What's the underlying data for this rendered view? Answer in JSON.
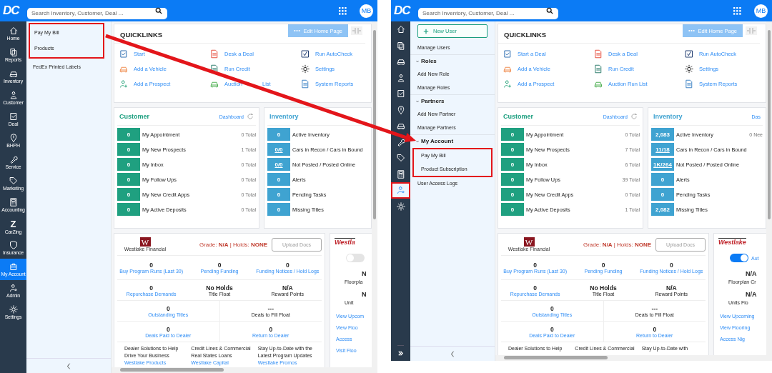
{
  "screens": [
    {
      "header": {
        "logo": "DC",
        "search_placeholder": "Search Inventory, Customer, Deal ...",
        "avatar": "MB"
      },
      "rail": [
        {
          "kind": "home",
          "label": "Home",
          "selected": false,
          "highlighted": false
        },
        {
          "kind": "reports",
          "label": "Reports",
          "selected": false,
          "highlighted": false
        },
        {
          "kind": "car",
          "label": "Inventory",
          "selected": false,
          "highlighted": false
        },
        {
          "kind": "person",
          "label": "Customer",
          "selected": false,
          "highlighted": false
        },
        {
          "kind": "deal",
          "label": "Deal",
          "selected": false,
          "highlighted": false
        },
        {
          "kind": "pin",
          "label": "BHPH",
          "selected": false,
          "highlighted": false
        },
        {
          "kind": "wrench",
          "label": "Service",
          "selected": false,
          "highlighted": false
        },
        {
          "kind": "tag",
          "label": "Marketing",
          "selected": false,
          "highlighted": false
        },
        {
          "kind": "calculator",
          "label": "Accounting",
          "selected": false,
          "highlighted": false
        },
        {
          "kind": "glyph",
          "glyph": "Z",
          "label": "CarZing",
          "selected": false,
          "highlighted": false
        },
        {
          "kind": "shield",
          "label": "Insurance",
          "selected": false,
          "highlighted": false
        },
        {
          "kind": "account",
          "label": "My Account",
          "selected": true,
          "highlighted": false
        },
        {
          "kind": "admin",
          "label": "Admin",
          "selected": false,
          "highlighted": false
        },
        {
          "kind": "gear",
          "label": "Settings",
          "selected": false,
          "highlighted": false
        }
      ],
      "rail_expand": false,
      "submenu": [
        {
          "kind": "highlight",
          "children": [
            {
              "kind": "link",
              "label": "Pay My Bill"
            },
            {
              "kind": "link",
              "label": "Products"
            }
          ]
        },
        {
          "kind": "link",
          "label": "FedEx Printed Labels"
        }
      ],
      "quicklinks": {
        "title": "QUICKLINKS",
        "edit_button": "Edit Home Page",
        "links": [
          {
            "kind": "deal",
            "label": "Start"
          },
          {
            "kind": "desk",
            "label": "Desk a Deal"
          },
          {
            "kind": "check",
            "label": "Run AutoCheck"
          },
          {
            "kind": "car",
            "label": "Add a Vehicle"
          },
          {
            "kind": "credit",
            "label": "Run Credit"
          },
          {
            "kind": "gear",
            "label": "Settings"
          },
          {
            "kind": "prospect",
            "label": "Add a Prospect"
          },
          {
            "kind": "auction",
            "label": "Auction",
            "tail": "List"
          },
          {
            "kind": "report",
            "label": "System Reports"
          }
        ]
      },
      "customer": {
        "title": "Customer",
        "link": "Dashboard",
        "rows": [
          {
            "count": "0",
            "label": "My Appointment",
            "total": "0 Total"
          },
          {
            "count": "0",
            "label": "My New Prospects",
            "total": "1 Total"
          },
          {
            "count": "0",
            "label": "My Inbox",
            "total": "0 Total"
          },
          {
            "count": "0",
            "label": "My Follow Ups",
            "total": "0 Total"
          },
          {
            "count": "0",
            "label": "My New Credit Apps",
            "total": "0 Total"
          },
          {
            "count": "0",
            "label": "My Active Deposits",
            "total": "0 Total"
          }
        ]
      },
      "inventory": {
        "title": "Inventory",
        "rows": [
          {
            "count": "0",
            "kind": "plain",
            "label": "Active Inventory"
          },
          {
            "count": "0/0",
            "kind": "link",
            "label": "Cars in Recon / Cars in Bound"
          },
          {
            "count": "0/0",
            "kind": "link",
            "label": "Not Posted / Posted Online"
          },
          {
            "count": "0",
            "kind": "plain",
            "label": "Alerts"
          },
          {
            "count": "0",
            "kind": "plain",
            "label": "Pending Tasks"
          },
          {
            "count": "0",
            "kind": "plain",
            "label": "Missing Titles"
          }
        ]
      },
      "westlake": {
        "logo_mark": "W",
        "logo_text": "Westlake Financial",
        "grade": "Grade: **N/A** | Holds: **NONE**",
        "upload_button": "Upload Docs",
        "stat_rows": [
          [
            {
              "value": "0",
              "label": "Buy Program Runs (Last 30)",
              "kind": "link"
            },
            {
              "value": "0",
              "label": "Pending Funding",
              "kind": "link"
            },
            {
              "value": "0",
              "label": "Funding Notices / Hold Logs",
              "kind": "link"
            }
          ],
          [
            {
              "value": "0",
              "label": "Repurchase Demands",
              "kind": "link"
            },
            {
              "value": "No Holds",
              "label": "Title Float",
              "kind": "plain"
            },
            {
              "value": "N/A",
              "label": "Reward Points",
              "kind": "plain"
            }
          ],
          [
            {
              "value": "0",
              "label": "Outstanding Titles",
              "kind": "link"
            },
            {
              "value": "---",
              "label": "Deals to Fill Float",
              "kind": "plain"
            }
          ],
          [
            {
              "value": "0",
              "label": "Deals Paid to Dealer",
              "kind": "link"
            },
            {
              "value": "0",
              "label": "Return to Dealer",
              "kind": "link"
            }
          ]
        ],
        "promos": [
          {
            "text": "Dealer Solutions to Help Drive Your Business",
            "link": "Westlake Products"
          },
          {
            "text": "Credit Lines & Commercial Real States Loans",
            "link": "Westlake Capital"
          },
          {
            "text": "Stay Up-to-Date with the Latest Program Updates",
            "link": "Westlake Promos"
          }
        ]
      },
      "flooring": {
        "logo": "Westla",
        "toggle_on": false,
        "items": [
          {
            "kind": "value",
            "text": "N"
          },
          {
            "kind": "caption",
            "text": "Floorpla"
          },
          {
            "kind": "value",
            "text": "N"
          },
          {
            "kind": "caption",
            "text": "Unit"
          },
          {
            "kind": "link",
            "text": "View Upcom"
          },
          {
            "kind": "link",
            "text": "View Floo"
          },
          {
            "kind": "link",
            "text": "Access"
          },
          {
            "kind": "link",
            "text": "Visit Floo"
          }
        ]
      }
    },
    {
      "header": {
        "logo": "DC",
        "search_placeholder": "Search Inventory, Customer, Deal ...",
        "avatar": "MB"
      },
      "rail": [
        {
          "kind": "home",
          "selected": false,
          "highlighted": false
        },
        {
          "kind": "reports",
          "selected": false,
          "highlighted": false
        },
        {
          "kind": "car",
          "selected": false,
          "highlighted": false
        },
        {
          "kind": "person",
          "selected": false,
          "highlighted": false
        },
        {
          "kind": "deal",
          "selected": false,
          "highlighted": false
        },
        {
          "kind": "pin",
          "selected": false,
          "highlighted": false
        },
        {
          "kind": "car",
          "selected": false,
          "highlighted": false
        },
        {
          "kind": "wrench",
          "selected": false,
          "highlighted": false
        },
        {
          "kind": "tag",
          "selected": false,
          "highlighted": false
        },
        {
          "kind": "calculator",
          "selected": false,
          "highlighted": false
        },
        {
          "kind": "admin",
          "selected": true,
          "highlighted": true
        },
        {
          "kind": "gear",
          "selected": false,
          "highlighted": false
        }
      ],
      "rail_expand": true,
      "submenu": [
        {
          "kind": "button",
          "label": "New User"
        },
        {
          "kind": "link",
          "label": "Manage Users"
        },
        {
          "kind": "group",
          "label": "Roles",
          "expanded": true,
          "children": [
            {
              "kind": "link",
              "label": "Add New Role"
            },
            {
              "kind": "link",
              "label": "Manage Roles"
            }
          ]
        },
        {
          "kind": "group",
          "label": "Partners",
          "expanded": true,
          "children": [
            {
              "kind": "link",
              "label": "Add New Partner"
            },
            {
              "kind": "link",
              "label": "Manage Partners"
            }
          ]
        },
        {
          "kind": "group",
          "label": "My Account",
          "expanded": true,
          "children": [
            {
              "kind": "highlight",
              "children": [
                {
                  "kind": "link",
                  "label": "Pay My Bill"
                },
                {
                  "kind": "link",
                  "label": "Product Subscription"
                }
              ]
            },
            {
              "kind": "link",
              "label": "User Access Logs"
            }
          ]
        }
      ],
      "quicklinks": {
        "title": "QUICKLINKS",
        "edit_button": "Edit Home Page",
        "links": [
          {
            "kind": "deal",
            "label": "Start a Deal"
          },
          {
            "kind": "desk",
            "label": "Desk a Deal"
          },
          {
            "kind": "check",
            "label": "Run AutoCheck"
          },
          {
            "kind": "car",
            "label": "Add a Vehicle"
          },
          {
            "kind": "credit",
            "label": "Run Credit"
          },
          {
            "kind": "gear",
            "label": "Settings"
          },
          {
            "kind": "prospect",
            "label": "Add a Prospect"
          },
          {
            "kind": "auction",
            "label": "Auction Run List"
          },
          {
            "kind": "report",
            "label": "System Reports"
          }
        ]
      },
      "customer": {
        "title": "Customer",
        "link": "Dashboard",
        "rows": [
          {
            "count": "0",
            "label": "My Appointment",
            "total": "0 Total"
          },
          {
            "count": "0",
            "label": "My New Prospects",
            "total": "7 Total"
          },
          {
            "count": "0",
            "label": "My Inbox",
            "total": "6 Total"
          },
          {
            "count": "0",
            "label": "My Follow Ups",
            "total": "39 Total"
          },
          {
            "count": "0",
            "label": "My New Credit Apps",
            "total": "0 Total"
          },
          {
            "count": "0",
            "label": "My Active Deposits",
            "total": "1 Total"
          }
        ]
      },
      "inventory": {
        "title": "Inventory",
        "link": "Das",
        "rows": [
          {
            "count": "2,083",
            "kind": "plain",
            "label": "Active Inventory",
            "total": "0 Nee"
          },
          {
            "count": "11/18",
            "kind": "link",
            "label": "Cars in Recon / Cars in Bound"
          },
          {
            "count": "1K/264",
            "kind": "link",
            "label": "Not Posted / Posted Online"
          },
          {
            "count": "0",
            "kind": "plain",
            "label": "Alerts"
          },
          {
            "count": "0",
            "kind": "plain",
            "label": "Pending Tasks"
          },
          {
            "count": "2,082",
            "kind": "plain",
            "label": "Missing Titles"
          }
        ]
      },
      "westlake": {
        "logo_mark": "W",
        "logo_text": "Westlake Financial",
        "grade": "Grade: **N/A** | Holds: **NONE**",
        "upload_button": "Upload Docs",
        "stat_rows": [
          [
            {
              "value": "0",
              "label": "Buy Program Runs (Last 30)",
              "kind": "link"
            },
            {
              "value": "0",
              "label": "Pending Funding",
              "kind": "link"
            },
            {
              "value": "0",
              "label": "Funding Notices / Hold Logs",
              "kind": "link"
            }
          ],
          [
            {
              "value": "0",
              "label": "Repurchase Demands",
              "kind": "link"
            },
            {
              "value": "No Holds",
              "label": "Title Float",
              "kind": "plain"
            },
            {
              "value": "N/A",
              "label": "Reward Points",
              "kind": "plain"
            }
          ],
          [
            {
              "value": "0",
              "label": "Outstanding Titles",
              "kind": "link"
            },
            {
              "value": "---",
              "label": "Deals to Fill Float",
              "kind": "plain"
            }
          ],
          [
            {
              "value": "0",
              "label": "Deals Paid to Dealer",
              "kind": "link"
            },
            {
              "value": "0",
              "label": "Return to Dealer",
              "kind": "link"
            }
          ]
        ],
        "promos": [
          {
            "text": "Dealer Solutions to Help"
          },
          {
            "text": "Credit Lines & Commercial"
          },
          {
            "text": "Stay Up-to-Date with"
          }
        ]
      },
      "flooring": {
        "logo": "Westlake",
        "toggle_on": true,
        "toggle_label": "Aut",
        "items": [
          {
            "kind": "value",
            "text": "N/A"
          },
          {
            "kind": "caption",
            "text": "Floorplan Cr"
          },
          {
            "kind": "value",
            "text": "N/A"
          },
          {
            "kind": "caption",
            "text": "Units Flo"
          },
          {
            "kind": "link",
            "text": "View Upcoming"
          },
          {
            "kind": "link",
            "text": "View Flooring"
          },
          {
            "kind": "link",
            "text": "Access Nig"
          }
        ]
      }
    }
  ],
  "annotations": [
    {
      "kind": "arrow"
    }
  ]
}
